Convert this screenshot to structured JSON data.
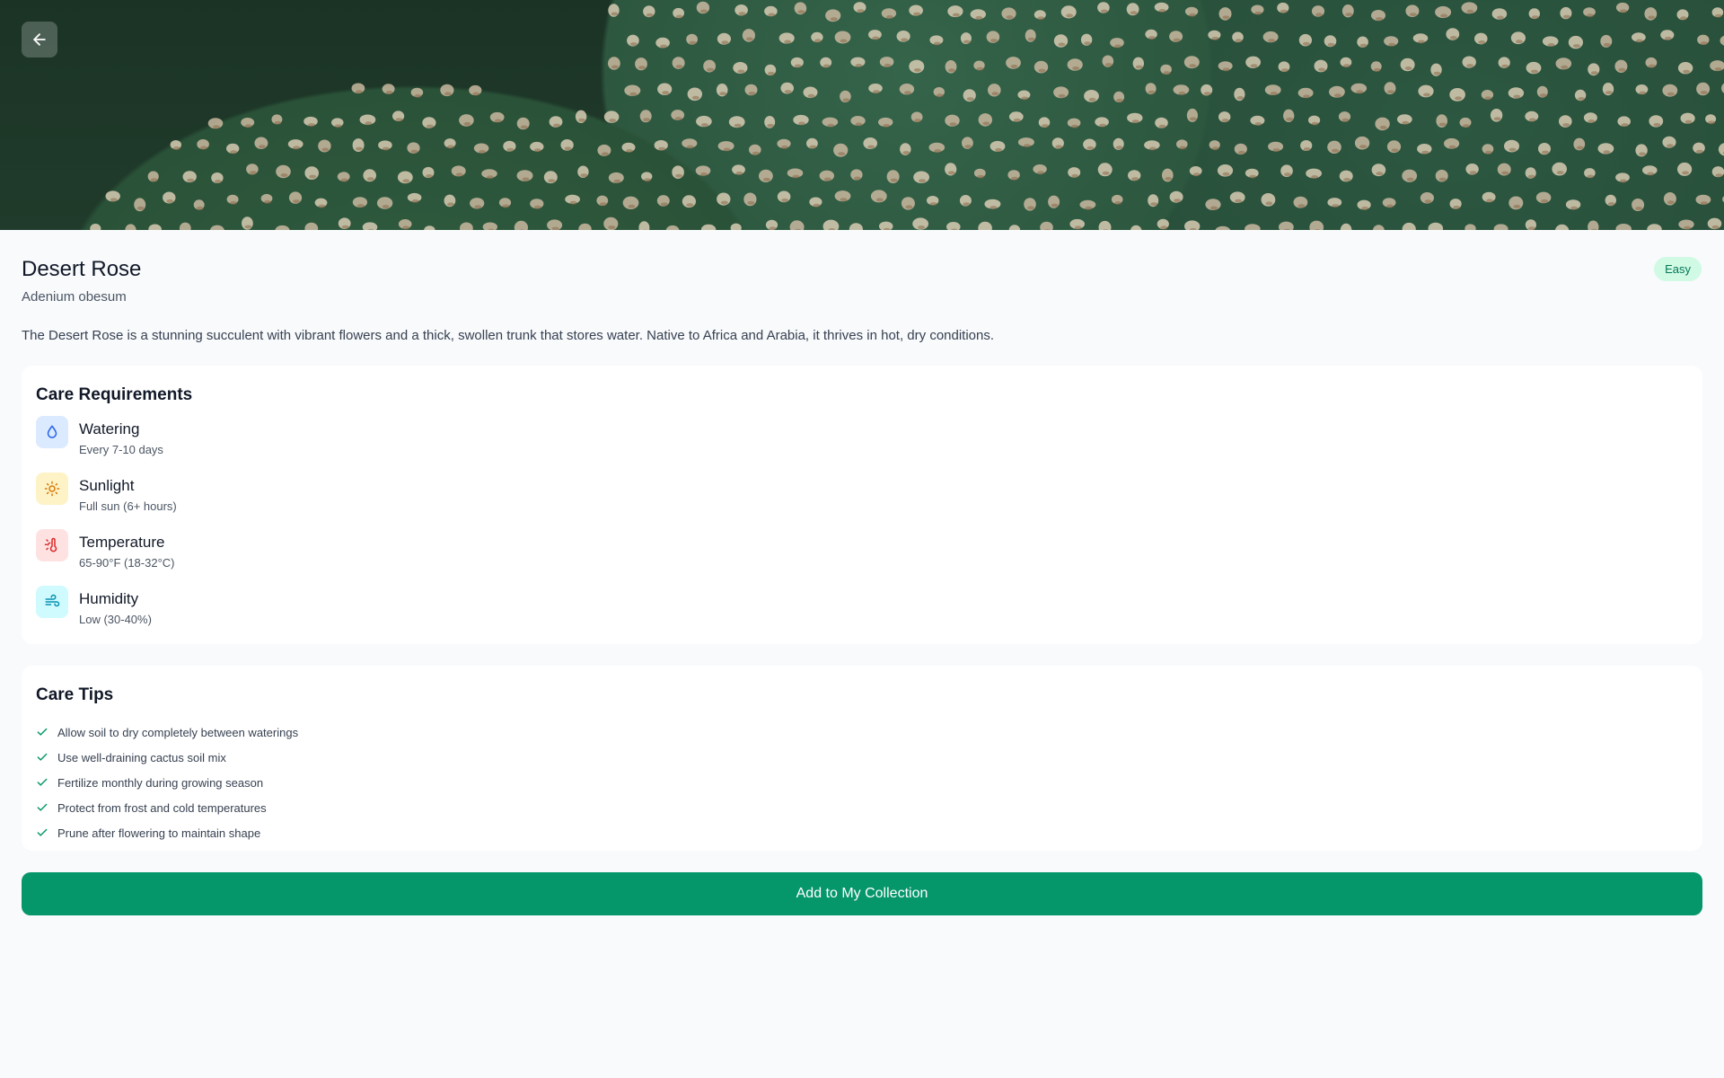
{
  "hero": {
    "back_icon": "arrow-left-icon",
    "image_subject": "cactus-pads"
  },
  "plant": {
    "name": "Desert Rose",
    "scientific_name": "Adenium obesum",
    "difficulty": "Easy",
    "description": "The Desert Rose is a stunning succulent with vibrant flowers and a thick, swollen trunk that stores water. Native to Africa and Arabia, it thrives in hot, dry conditions."
  },
  "care": {
    "title": "Care Requirements",
    "items": [
      {
        "label": "Watering",
        "value": "Every 7-10 days",
        "icon": "water-drop-icon",
        "bg": "#dbeafe",
        "color": "#2563eb"
      },
      {
        "label": "Sunlight",
        "value": "Full sun (6+ hours)",
        "icon": "sun-icon",
        "bg": "#fef3c7",
        "color": "#d97706"
      },
      {
        "label": "Temperature",
        "value": "65-90°F (18-32°C)",
        "icon": "thermometer-sun-icon",
        "bg": "#fee2e2",
        "color": "#dc2626"
      },
      {
        "label": "Humidity",
        "value": "Low (30-40%)",
        "icon": "wind-icon",
        "bg": "#cffafe",
        "color": "#0891b2"
      }
    ]
  },
  "tips": {
    "title": "Care Tips",
    "items": [
      "Allow soil to dry completely between waterings",
      "Use well-draining cactus soil mix",
      "Fertilize monthly during growing season",
      "Protect from frost and cold temperatures",
      "Prune after flowering to maintain shape"
    ]
  },
  "actions": {
    "add_label": "Add to My Collection"
  },
  "colors": {
    "accent": "#059669",
    "badge_bg": "#d1fae5",
    "badge_text": "#047857",
    "check": "#059669"
  }
}
